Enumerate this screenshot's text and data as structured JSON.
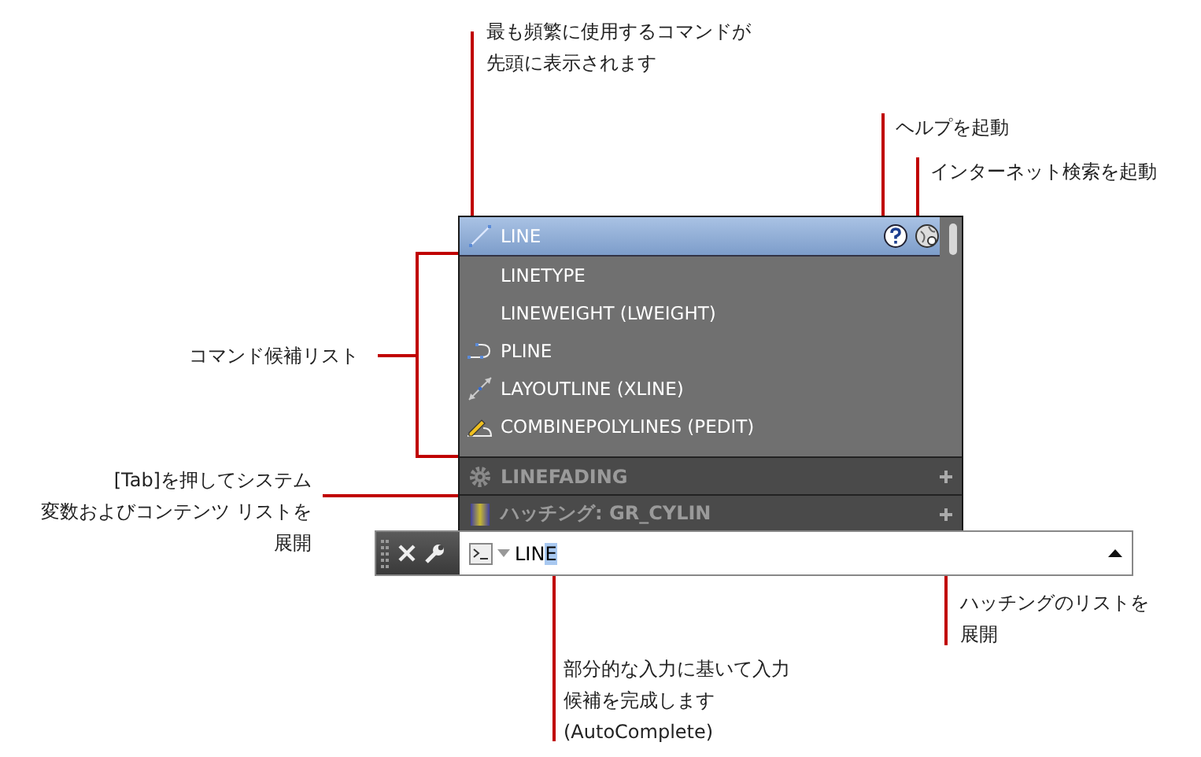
{
  "annotations": [
    {
      "lines": [
        "最も頻繁に使用するコマンドが",
        "先頭に表示されます"
      ]
    },
    {
      "lines": [
        "ヘルプを起動"
      ]
    },
    {
      "lines": [
        "インターネット検索を起動"
      ]
    },
    {
      "lines": [
        "コマンド候補リスト"
      ]
    },
    {
      "lines": [
        "[Tab]を押してシステム",
        "変数およびコンテンツ リストを",
        "展開"
      ]
    },
    {
      "lines": [
        "ハッチングのリストを",
        "展開"
      ]
    },
    {
      "lines": [
        "部分的な入力に基いて入力",
        "候補を完成します",
        "(AutoComplete)"
      ]
    }
  ],
  "suggestions": [
    {
      "label": "LINE",
      "kind": "line",
      "selected": true
    },
    {
      "label": "LINETYPE",
      "kind": "plain",
      "selected": false
    },
    {
      "label": "LINEWEIGHT (LWEIGHT)",
      "kind": "plain",
      "selected": false
    },
    {
      "label": "PLINE",
      "kind": "polyline",
      "selected": false
    },
    {
      "label": "LAYOUTLINE (XLINE)",
      "kind": "xline",
      "selected": false
    },
    {
      "label": "COMBINEPOLYLINES (PEDIT)",
      "kind": "edit",
      "selected": false
    }
  ],
  "sections": [
    {
      "label": "LINEFADING",
      "kind": "variable"
    },
    {
      "label": "ハッチング: GR_CYLIN",
      "kind": "hatch"
    }
  ],
  "command": {
    "typed": "LIN",
    "completion": "E"
  }
}
